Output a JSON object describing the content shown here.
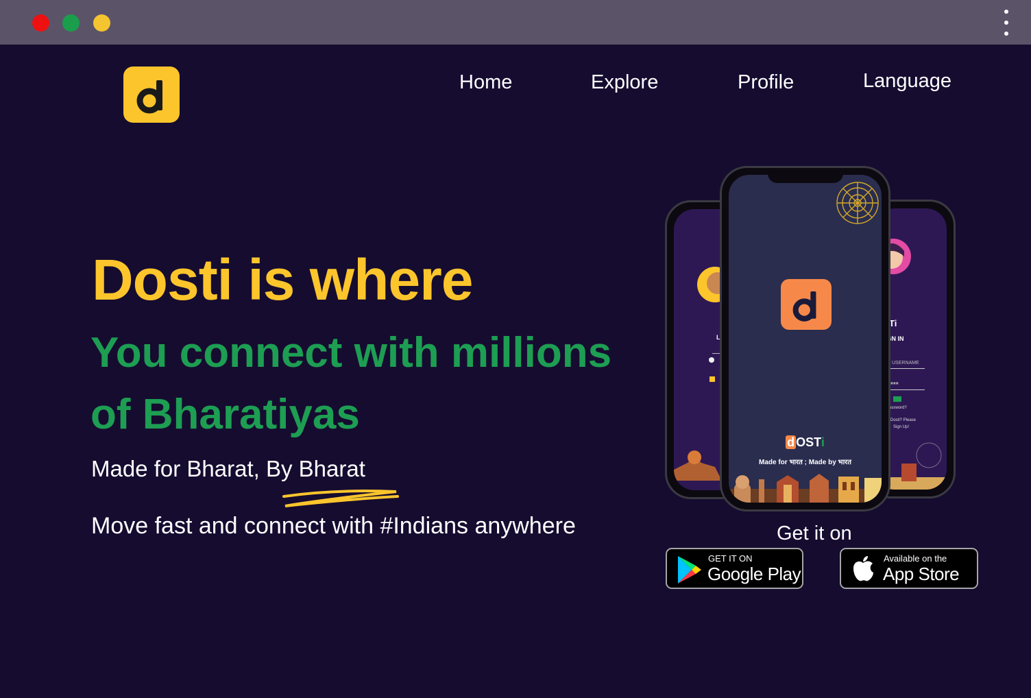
{
  "window": {
    "controls": [
      "close",
      "minimize",
      "maximize"
    ],
    "menu_icon": "kebab-menu-icon"
  },
  "brand": {
    "logo_letter": "d",
    "logo_color": "#fcc52c"
  },
  "nav": {
    "items": [
      "Home",
      "Explore",
      "Profile",
      "Language"
    ]
  },
  "hero": {
    "headline": "Dosti is where",
    "subhead": "You connect with millions of Bharatiyas",
    "tagline": "Made for Bharat, By Bharat",
    "description": "Move fast and connect with #Indians anywhere"
  },
  "phones": {
    "center": {
      "logo_letter": "d",
      "brand_d": "d",
      "brand_ost": "OST",
      "brand_i": "i",
      "made_line": "Made for भारत ; Made by भारत"
    },
    "left": {
      "heading": "L"
    },
    "right": {
      "brand_fragment": "Ti",
      "heading": "SIGN IN",
      "username_placeholder": "USERNAME",
      "password_mask": "***",
      "forgot": "assword?",
      "signup_prompt": "Dosti? Please",
      "signup_link": "Sign Up!"
    }
  },
  "download": {
    "label": "Get it on",
    "google": {
      "small": "GET IT ON",
      "big": "Google Play"
    },
    "apple": {
      "small": "Available on the",
      "big": "App Store"
    }
  },
  "colors": {
    "background": "#160c30",
    "accent_yellow": "#fcc52c",
    "accent_green": "#1d9e52",
    "accent_orange": "#f6894a"
  }
}
